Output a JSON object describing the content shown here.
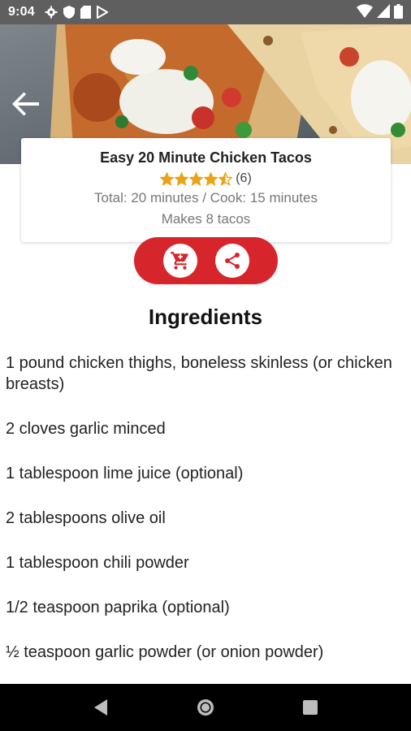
{
  "status_bar": {
    "time": "9:04"
  },
  "recipe": {
    "title": "Easy 20 Minute Chicken Tacos",
    "rating": 4.5,
    "rating_count": "(6)",
    "time_info": "Total: 20 minutes / Cook: 15 minutes",
    "yield": "Makes 8 tacos"
  },
  "colors": {
    "accent": "#d7262b",
    "star": "#e8a317",
    "status_bar": "#5f5f5f"
  },
  "actions": [
    {
      "name": "add-to-cart",
      "icon": "shopping-cart-icon"
    },
    {
      "name": "share",
      "icon": "share-icon"
    }
  ],
  "ingredients_title": "Ingredients",
  "ingredients": [
    "1 pound chicken thighs, boneless skinless (or chicken breasts)",
    "2 cloves garlic minced",
    "1 tablespoon lime juice  (optional)",
    "2 tablespoons olive oil",
    "1 tablespoon chili powder",
    "1/2 teaspoon paprika (optional)",
    "½ teaspoon garlic powder (or onion powder)"
  ]
}
